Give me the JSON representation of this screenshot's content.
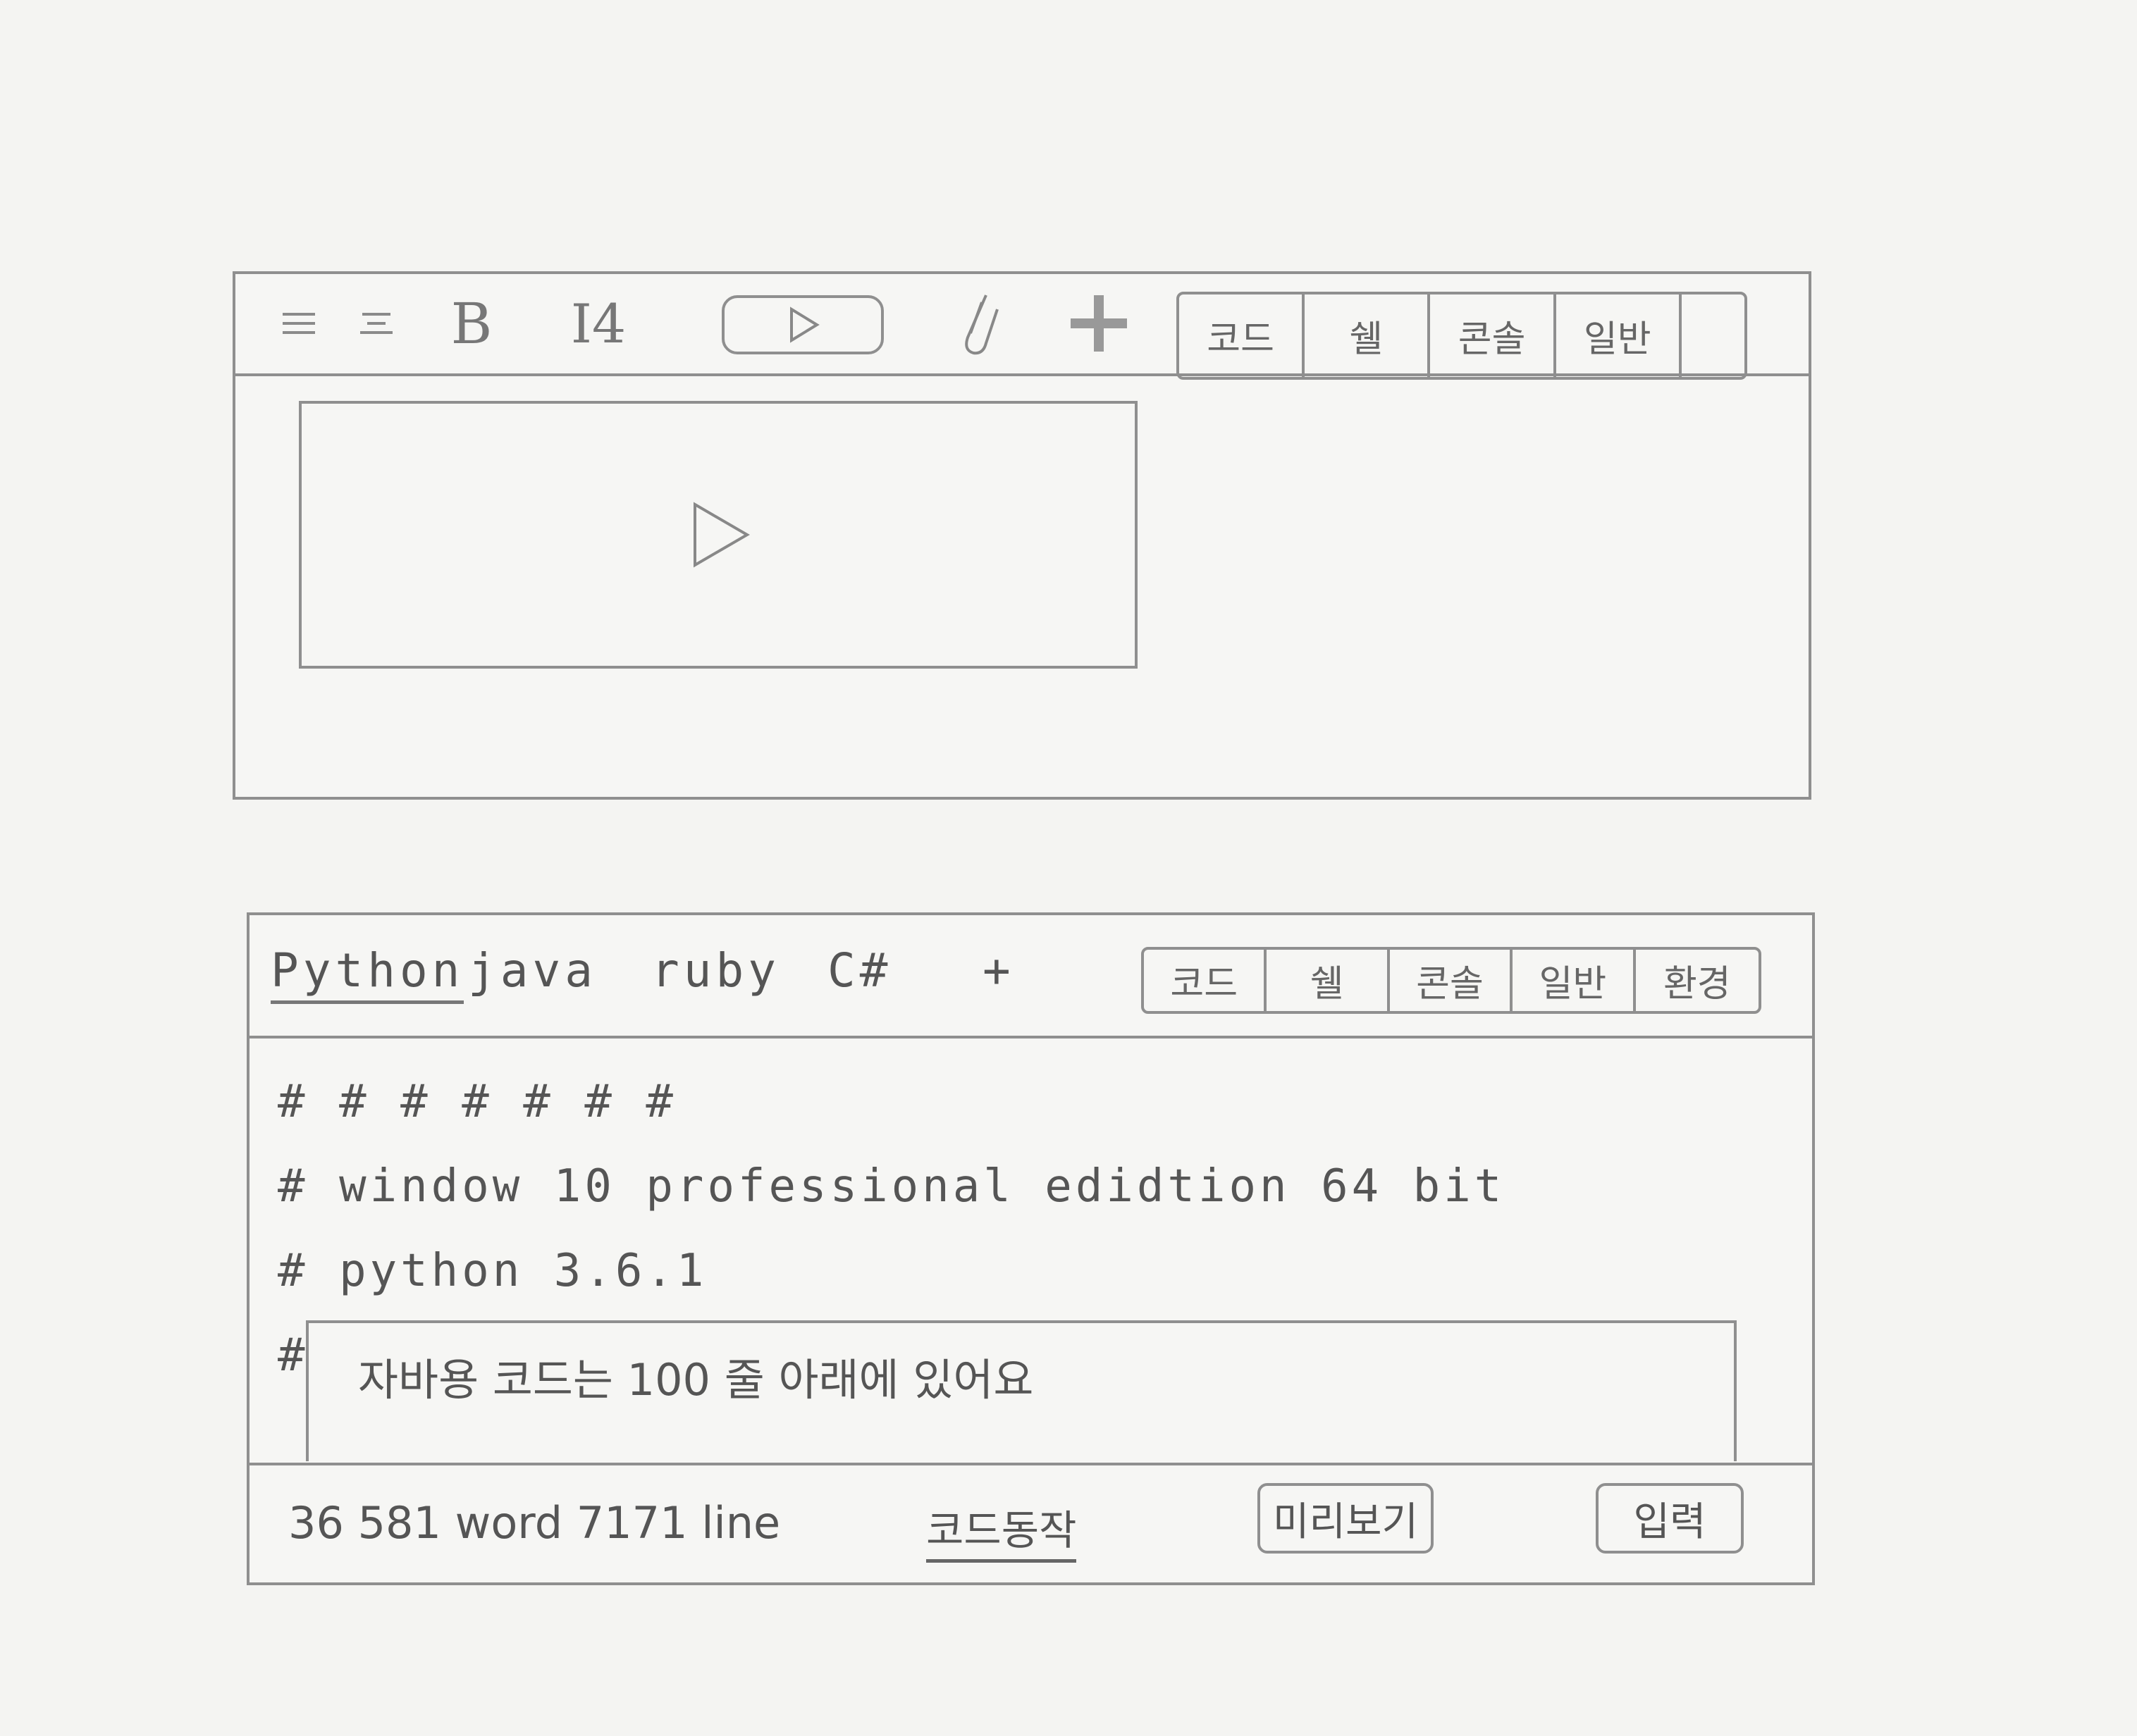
{
  "editor": {
    "toolbar": {
      "icons": [
        "align-left-icon",
        "align-center-icon",
        "bold-icon",
        "font-size-icon",
        "video-icon",
        "attach-icon",
        "add-icon"
      ],
      "bold_label": "B",
      "font_size_label": "I4",
      "tabs": [
        "코드",
        "쉘",
        "콘솔",
        "일반",
        ""
      ]
    }
  },
  "code": {
    "languages": [
      "Python",
      "java",
      "ruby",
      "C#"
    ],
    "active_language": "Python",
    "add_label": "+",
    "tabs": [
      "코드",
      "쉘",
      "콘솔",
      "일반",
      "환경"
    ],
    "lines": [
      "# # # # # # #",
      "# window 10 professional edidtion 64 bit",
      "# python 3.6.1",
      "#"
    ],
    "notice": "자바용 코드는 100 줄 아래에 있어요"
  },
  "status": {
    "counts": "36 581 word 7171 line",
    "code_run": "코드동작",
    "preview": "미리보기",
    "submit": "입력"
  }
}
